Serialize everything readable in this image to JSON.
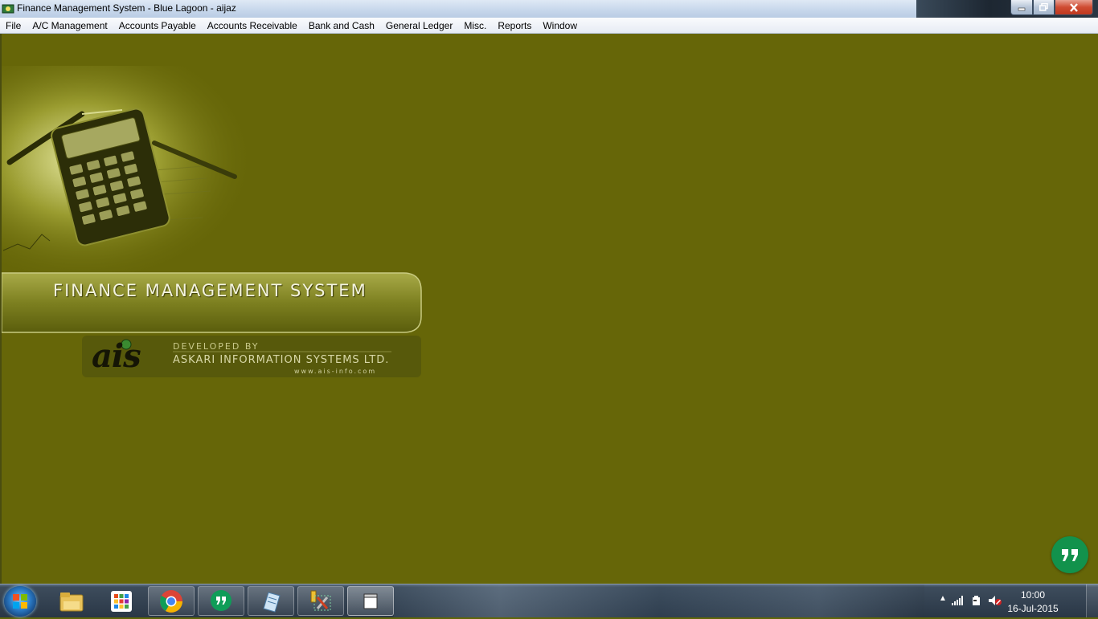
{
  "window": {
    "title": "Finance Management System - Blue Lagoon - aijaz",
    "minimize_label": "minimize",
    "maximize_label": "restore",
    "close_label": "close"
  },
  "menu": {
    "items": [
      {
        "label": "File"
      },
      {
        "label": "A/C Management"
      },
      {
        "label": "Accounts Payable"
      },
      {
        "label": "Accounts Receivable"
      },
      {
        "label": "Bank and Cash"
      },
      {
        "label": "General Ledger"
      },
      {
        "label": "Misc."
      },
      {
        "label": "Reports"
      },
      {
        "label": "Window"
      }
    ]
  },
  "splash": {
    "title": "FINANCE MANAGEMENT SYSTEM",
    "developed_by": "DEVELOPED BY",
    "company": "ASKARI INFORMATION SYSTEMS LTD.",
    "url": "www.ais-info.com",
    "logo_text": "ais"
  },
  "taskbar": {
    "pinned": [
      {
        "name": "windows-explorer-icon",
        "state": "pinned"
      },
      {
        "name": "apps-grid-icon",
        "state": "pinned"
      },
      {
        "name": "chrome-icon",
        "state": "open"
      },
      {
        "name": "hangouts-icon",
        "state": "open"
      },
      {
        "name": "notepad-icon",
        "state": "open"
      },
      {
        "name": "tools-icon",
        "state": "open"
      },
      {
        "name": "finance-window-icon",
        "state": "active"
      }
    ],
    "clock": {
      "time": "10:00",
      "date": "16-Jul-2015"
    }
  },
  "colors": {
    "workspace": "#666608",
    "banner": "#7d8020",
    "hangouts": "#12924c"
  }
}
